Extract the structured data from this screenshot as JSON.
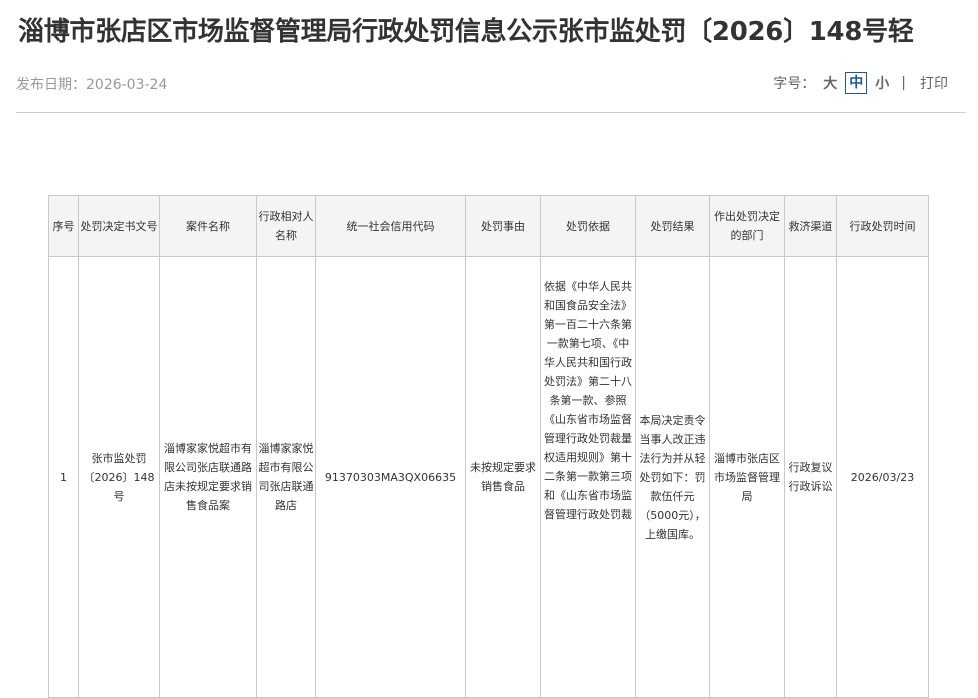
{
  "header": {
    "title": "淄博市张店区市场监督管理局行政处罚信息公示张市监处罚〔2026〕148号轻",
    "publish_date": "发布日期：2026-03-24",
    "font_size_label": "字号：",
    "font_sizes": [
      "大",
      "中",
      "小"
    ],
    "active_font_size": "中",
    "separator": "|",
    "print_label": "打印"
  },
  "table": {
    "headers": [
      "序号",
      "处罚决定书文号",
      "案件名称",
      "行政相对人名称",
      "统一社会信用代码",
      "处罚事由",
      "处罚依据",
      "处罚结果",
      "作出处罚决定的部门",
      "救济渠道",
      "行政处罚时间"
    ],
    "rows": [
      {
        "no": "1",
        "doc_no": "张市监处罚〔2026〕148号",
        "case_name": "淄博家家悦超市有限公司张店联通路店未按规定要求销售食品案",
        "party": "淄博家家悦超市有限公司张店联通路店",
        "credit_code": "91370303MA3QX06635",
        "reason": "未按规定要求销售食品",
        "basis": "依据《中华人民共和国食品安全法》第一百二十六条第一款第七项、《中华人民共和国行政处罚法》第二十八条第一款、参照《山东省市场监督管理行政处罚裁量权适用规则》第十二条第一款第三项和《山东省市场监督管理行政处罚裁",
        "result": "本局决定责令当事人改正违法行为并从轻处罚如下：罚款伍仟元（5000元），上缴国库。",
        "dept": "淄博市张店区市场监督管理局",
        "remedy": "行政复议 行政诉讼",
        "date": "2026/03/23"
      }
    ]
  }
}
